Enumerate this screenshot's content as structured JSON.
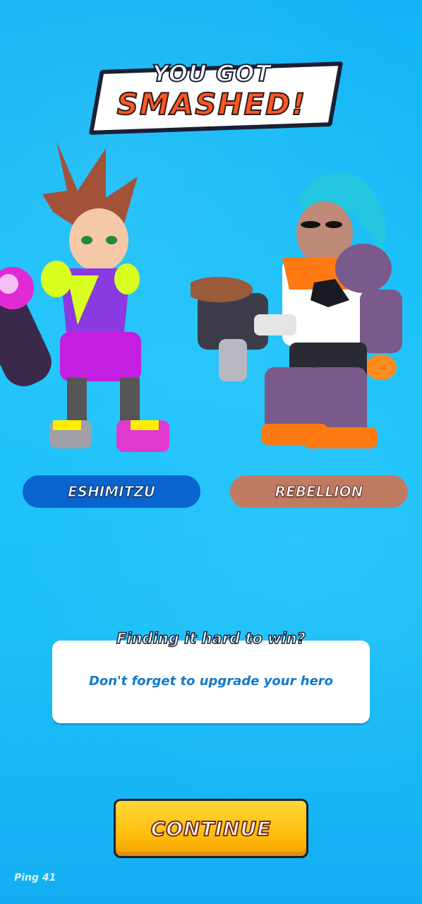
{
  "banner": {
    "line1": "YOU GOT",
    "line2": "SMASHED!"
  },
  "players": [
    {
      "name": "ESHIMITZU",
      "color": "#0a64cf"
    },
    {
      "name": "REBELLION",
      "color": "#c07a62"
    }
  ],
  "tip": {
    "title": "Finding it hard to win?",
    "text": "Don't forget to upgrade your hero"
  },
  "continue_label": "CONTINUE",
  "ping": "Ping 41",
  "colors": {
    "background": "#1ec4fb",
    "accent_orange": "#ff5722",
    "button_yellow": "#ffc21a"
  }
}
